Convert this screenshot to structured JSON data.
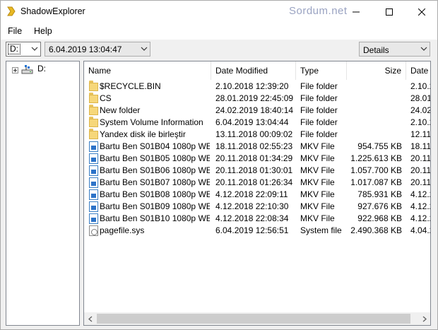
{
  "window": {
    "title": "ShadowExplorer",
    "watermark": "Sordum.net"
  },
  "menu": {
    "file": "File",
    "help": "Help"
  },
  "toolbar": {
    "drive": "D:",
    "snapshot_date": "6.04.2019 13:04:47",
    "view": "Details"
  },
  "tree": {
    "root_label": "D:"
  },
  "list": {
    "columns": {
      "name": "Name",
      "date_modified": "Date Modified",
      "type": "Type",
      "size": "Size",
      "date": "Date"
    },
    "rows": [
      {
        "icon": "folder-icon",
        "name": "$RECYCLE.BIN",
        "date": "2.10.2018 12:39:20",
        "type": "File folder",
        "size": "",
        "date2": "2.10.2"
      },
      {
        "icon": "folder-icon",
        "name": "CS",
        "date": "28.01.2019 22:45:09",
        "type": "File folder",
        "size": "",
        "date2": "28.01"
      },
      {
        "icon": "folder-icon",
        "name": "New folder",
        "date": "24.02.2019 18:40:14",
        "type": "File folder",
        "size": "",
        "date2": "24.02"
      },
      {
        "icon": "folder-icon",
        "name": "System Volume Information",
        "date": "6.04.2019 13:04:44",
        "type": "File folder",
        "size": "",
        "date2": "2.10.2"
      },
      {
        "icon": "folder-icon",
        "name": "Yandex disk ile birleştir",
        "date": "13.11.2018 00:09:02",
        "type": "File folder",
        "size": "",
        "date2": "12.11"
      },
      {
        "icon": "video-file-icon",
        "name": "Bartu Ben S01B04 1080p WE...",
        "date": "18.11.2018 02:55:23",
        "type": "MKV File",
        "size": "954.755 KB",
        "date2": "18.11"
      },
      {
        "icon": "video-file-icon",
        "name": "Bartu Ben S01B05 1080p WE...",
        "date": "20.11.2018 01:34:29",
        "type": "MKV File",
        "size": "1.225.613 KB",
        "date2": "20.11"
      },
      {
        "icon": "video-file-icon",
        "name": "Bartu Ben S01B06 1080p WE...",
        "date": "20.11.2018 01:30:01",
        "type": "MKV File",
        "size": "1.057.700 KB",
        "date2": "20.11"
      },
      {
        "icon": "video-file-icon",
        "name": "Bartu Ben S01B07 1080p WE...",
        "date": "20.11.2018 01:26:34",
        "type": "MKV File",
        "size": "1.017.087 KB",
        "date2": "20.11"
      },
      {
        "icon": "video-file-icon",
        "name": "Bartu Ben S01B08 1080p WE...",
        "date": "4.12.2018 22:09:11",
        "type": "MKV File",
        "size": "785.931 KB",
        "date2": "4.12.2"
      },
      {
        "icon": "video-file-icon",
        "name": "Bartu Ben S01B09 1080p WE...",
        "date": "4.12.2018 22:10:30",
        "type": "MKV File",
        "size": "927.676 KB",
        "date2": "4.12.2"
      },
      {
        "icon": "video-file-icon",
        "name": "Bartu Ben S01B10 1080p WE...",
        "date": "4.12.2018 22:08:34",
        "type": "MKV File",
        "size": "922.968 KB",
        "date2": "4.12.2"
      },
      {
        "icon": "system-file-icon",
        "name": "pagefile.sys",
        "date": "6.04.2019 12:56:51",
        "type": "System file",
        "size": "2.490.368 KB",
        "date2": "4.04.2"
      }
    ]
  }
}
